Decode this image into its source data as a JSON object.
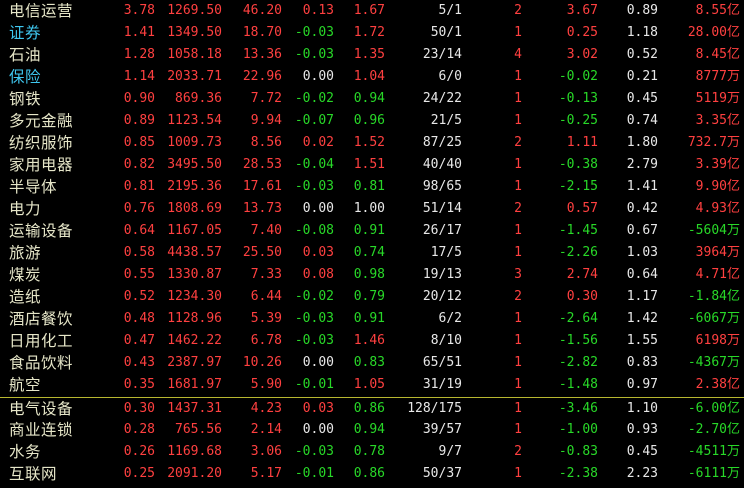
{
  "colors": {
    "background": "#000000",
    "up": "#ff4040",
    "down": "#28d828",
    "flat": "#e8e8e8",
    "name": "#e6e6c8",
    "link_name": "#3fc8f0",
    "separator": "#b8b830"
  },
  "rows": [
    {
      "name": "电信运营",
      "link": false,
      "v1": "3.78",
      "v2": "1269.50",
      "v3": "46.20",
      "v4": "0.13",
      "v5": "1.67",
      "v6": "5/1",
      "v7": "2",
      "v8": "3.67",
      "v9": "0.89",
      "v10": "8.55",
      "unit": "亿",
      "c1": "red",
      "c2": "red",
      "c3": "red",
      "c4": "red",
      "c5": "red",
      "c8": "red",
      "c10": "red"
    },
    {
      "name": "证券",
      "link": true,
      "v1": "1.41",
      "v2": "1349.50",
      "v3": "18.70",
      "v4": "-0.03",
      "v5": "1.72",
      "v6": "50/1",
      "v7": "1",
      "v8": "0.25",
      "v9": "1.18",
      "v10": "28.00",
      "unit": "亿",
      "c1": "red",
      "c2": "red",
      "c3": "red",
      "c4": "green",
      "c5": "red",
      "c8": "red",
      "c10": "red"
    },
    {
      "name": "石油",
      "link": false,
      "v1": "1.28",
      "v2": "1058.18",
      "v3": "13.36",
      "v4": "-0.03",
      "v5": "1.35",
      "v6": "23/14",
      "v7": "4",
      "v8": "3.02",
      "v9": "0.52",
      "v10": "8.45",
      "unit": "亿",
      "c1": "red",
      "c2": "red",
      "c3": "red",
      "c4": "green",
      "c5": "red",
      "c8": "red",
      "c10": "red"
    },
    {
      "name": "保险",
      "link": true,
      "v1": "1.14",
      "v2": "2033.71",
      "v3": "22.96",
      "v4": "0.00",
      "v5": "1.04",
      "v6": "6/0",
      "v7": "1",
      "v8": "-0.02",
      "v9": "0.21",
      "v10": "8777",
      "unit": "万",
      "c1": "red",
      "c2": "red",
      "c3": "red",
      "c4": "white",
      "c5": "red",
      "c8": "green",
      "c10": "red"
    },
    {
      "name": "钢铁",
      "link": false,
      "v1": "0.90",
      "v2": "869.36",
      "v3": "7.72",
      "v4": "-0.02",
      "v5": "0.94",
      "v6": "24/22",
      "v7": "1",
      "v8": "-0.13",
      "v9": "0.45",
      "v10": "5119",
      "unit": "万",
      "c1": "red",
      "c2": "red",
      "c3": "red",
      "c4": "green",
      "c5": "green",
      "c8": "green",
      "c10": "red"
    },
    {
      "name": "多元金融",
      "link": false,
      "v1": "0.89",
      "v2": "1123.54",
      "v3": "9.94",
      "v4": "-0.07",
      "v5": "0.96",
      "v6": "21/5",
      "v7": "1",
      "v8": "-0.25",
      "v9": "0.74",
      "v10": "3.35",
      "unit": "亿",
      "c1": "red",
      "c2": "red",
      "c3": "red",
      "c4": "green",
      "c5": "green",
      "c8": "green",
      "c10": "red"
    },
    {
      "name": "纺织服饰",
      "link": false,
      "v1": "0.85",
      "v2": "1009.73",
      "v3": "8.56",
      "v4": "0.02",
      "v5": "1.52",
      "v6": "87/25",
      "v7": "2",
      "v8": "1.11",
      "v9": "1.80",
      "v10": "732.7",
      "unit": "万",
      "c1": "red",
      "c2": "red",
      "c3": "red",
      "c4": "red",
      "c5": "red",
      "c8": "red",
      "c10": "red"
    },
    {
      "name": "家用电器",
      "link": false,
      "v1": "0.82",
      "v2": "3495.50",
      "v3": "28.53",
      "v4": "-0.04",
      "v5": "1.51",
      "v6": "40/40",
      "v7": "1",
      "v8": "-0.38",
      "v9": "2.79",
      "v10": "3.39",
      "unit": "亿",
      "c1": "red",
      "c2": "red",
      "c3": "red",
      "c4": "green",
      "c5": "red",
      "c8": "green",
      "c10": "red"
    },
    {
      "name": "半导体",
      "link": false,
      "v1": "0.81",
      "v2": "2195.36",
      "v3": "17.61",
      "v4": "-0.03",
      "v5": "0.81",
      "v6": "98/65",
      "v7": "1",
      "v8": "-2.15",
      "v9": "1.41",
      "v10": "9.90",
      "unit": "亿",
      "c1": "red",
      "c2": "red",
      "c3": "red",
      "c4": "green",
      "c5": "green",
      "c8": "green",
      "c10": "red"
    },
    {
      "name": "电力",
      "link": false,
      "v1": "0.76",
      "v2": "1808.69",
      "v3": "13.73",
      "v4": "0.00",
      "v5": "1.00",
      "v6": "51/14",
      "v7": "2",
      "v8": "0.57",
      "v9": "0.42",
      "v10": "4.93",
      "unit": "亿",
      "c1": "red",
      "c2": "red",
      "c3": "red",
      "c4": "white",
      "c5": "white",
      "c8": "red",
      "c10": "red"
    },
    {
      "name": "运输设备",
      "link": false,
      "v1": "0.64",
      "v2": "1167.05",
      "v3": "7.40",
      "v4": "-0.08",
      "v5": "0.91",
      "v6": "26/17",
      "v7": "1",
      "v8": "-1.45",
      "v9": "0.67",
      "v10": "-5604",
      "unit": "万",
      "c1": "red",
      "c2": "red",
      "c3": "red",
      "c4": "green",
      "c5": "green",
      "c8": "green",
      "c10": "green"
    },
    {
      "name": "旅游",
      "link": false,
      "v1": "0.58",
      "v2": "4438.57",
      "v3": "25.50",
      "v4": "0.03",
      "v5": "0.74",
      "v6": "17/5",
      "v7": "1",
      "v8": "-2.26",
      "v9": "1.03",
      "v10": "3964",
      "unit": "万",
      "c1": "red",
      "c2": "red",
      "c3": "red",
      "c4": "red",
      "c5": "green",
      "c8": "green",
      "c10": "red"
    },
    {
      "name": "煤炭",
      "link": false,
      "v1": "0.55",
      "v2": "1330.87",
      "v3": "7.33",
      "v4": "0.08",
      "v5": "0.98",
      "v6": "19/13",
      "v7": "3",
      "v8": "2.74",
      "v9": "0.64",
      "v10": "4.71",
      "unit": "亿",
      "c1": "red",
      "c2": "red",
      "c3": "red",
      "c4": "red",
      "c5": "green",
      "c8": "red",
      "c10": "red"
    },
    {
      "name": "造纸",
      "link": false,
      "v1": "0.52",
      "v2": "1234.30",
      "v3": "6.44",
      "v4": "-0.02",
      "v5": "0.79",
      "v6": "20/12",
      "v7": "2",
      "v8": "0.30",
      "v9": "1.17",
      "v10": "-1.84",
      "unit": "亿",
      "c1": "red",
      "c2": "red",
      "c3": "red",
      "c4": "green",
      "c5": "green",
      "c8": "red",
      "c10": "green"
    },
    {
      "name": "酒店餐饮",
      "link": false,
      "v1": "0.48",
      "v2": "1128.96",
      "v3": "5.39",
      "v4": "-0.03",
      "v5": "0.91",
      "v6": "6/2",
      "v7": "1",
      "v8": "-2.64",
      "v9": "1.42",
      "v10": "-6067",
      "unit": "万",
      "c1": "red",
      "c2": "red",
      "c3": "red",
      "c4": "green",
      "c5": "green",
      "c8": "green",
      "c10": "green"
    },
    {
      "name": "日用化工",
      "link": false,
      "v1": "0.47",
      "v2": "1462.22",
      "v3": "6.78",
      "v4": "-0.03",
      "v5": "1.46",
      "v6": "8/10",
      "v7": "1",
      "v8": "-1.56",
      "v9": "1.55",
      "v10": "6198",
      "unit": "万",
      "c1": "red",
      "c2": "red",
      "c3": "red",
      "c4": "green",
      "c5": "red",
      "c8": "green",
      "c10": "red"
    },
    {
      "name": "食品饮料",
      "link": false,
      "v1": "0.43",
      "v2": "2387.97",
      "v3": "10.26",
      "v4": "0.00",
      "v5": "0.83",
      "v6": "65/51",
      "v7": "1",
      "v8": "-2.82",
      "v9": "0.83",
      "v10": "-4367",
      "unit": "万",
      "c1": "red",
      "c2": "red",
      "c3": "red",
      "c4": "white",
      "c5": "green",
      "c8": "green",
      "c10": "green"
    },
    {
      "name": "航空",
      "link": false,
      "v1": "0.35",
      "v2": "1681.97",
      "v3": "5.90",
      "v4": "-0.01",
      "v5": "1.05",
      "v6": "31/19",
      "v7": "1",
      "v8": "-1.48",
      "v9": "0.97",
      "v10": "2.38",
      "unit": "亿",
      "c1": "red",
      "c2": "red",
      "c3": "red",
      "c4": "green",
      "c5": "red",
      "c8": "green",
      "c10": "red"
    },
    {
      "name": "电气设备",
      "link": false,
      "v1": "0.30",
      "v2": "1437.31",
      "v3": "4.23",
      "v4": "0.03",
      "v5": "0.86",
      "v6": "128/175",
      "v7": "1",
      "v8": "-3.46",
      "v9": "1.10",
      "v10": "-6.00",
      "unit": "亿",
      "c1": "red",
      "c2": "red",
      "c3": "red",
      "c4": "red",
      "c5": "green",
      "c8": "green",
      "c10": "green"
    },
    {
      "name": "商业连锁",
      "link": false,
      "v1": "0.28",
      "v2": "765.56",
      "v3": "2.14",
      "v4": "0.00",
      "v5": "0.94",
      "v6": "39/57",
      "v7": "1",
      "v8": "-1.00",
      "v9": "0.93",
      "v10": "-2.70",
      "unit": "亿",
      "c1": "red",
      "c2": "red",
      "c3": "red",
      "c4": "white",
      "c5": "green",
      "c8": "green",
      "c10": "green"
    },
    {
      "name": "水务",
      "link": false,
      "v1": "0.26",
      "v2": "1169.68",
      "v3": "3.06",
      "v4": "-0.03",
      "v5": "0.78",
      "v6": "9/7",
      "v7": "2",
      "v8": "-0.83",
      "v9": "0.45",
      "v10": "-4511",
      "unit": "万",
      "c1": "red",
      "c2": "red",
      "c3": "red",
      "c4": "green",
      "c5": "green",
      "c8": "green",
      "c10": "green"
    },
    {
      "name": "互联网",
      "link": false,
      "v1": "0.25",
      "v2": "2091.20",
      "v3": "5.17",
      "v4": "-0.01",
      "v5": "0.86",
      "v6": "50/37",
      "v7": "1",
      "v8": "-2.38",
      "v9": "2.23",
      "v10": "-6111",
      "unit": "万",
      "c1": "red",
      "c2": "red",
      "c3": "red",
      "c4": "green",
      "c5": "green",
      "c8": "green",
      "c10": "green"
    }
  ]
}
